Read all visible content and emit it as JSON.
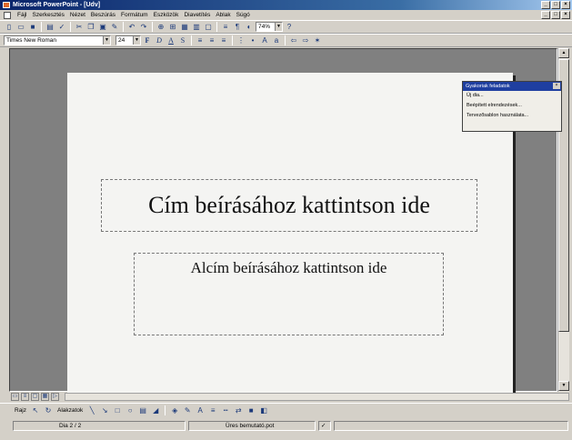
{
  "window": {
    "title": "Microsoft PowerPoint - [Udv]",
    "controls": [
      "_",
      "□",
      "×"
    ]
  },
  "menubar": {
    "items": [
      "Fájl",
      "Szerkesztés",
      "Nézet",
      "Beszúrás",
      "Formátum",
      "Eszközök",
      "Diavetítés",
      "Ablak",
      "Súgó"
    ]
  },
  "toolbar": {
    "zoom": "74%",
    "font_name": "Times New Roman",
    "font_size": "24",
    "format_labels": {
      "bold": "F",
      "italic": "D",
      "underline": "A",
      "shadow": "S"
    }
  },
  "slide": {
    "title_placeholder": "Cím beírásához kattintson ide",
    "subtitle_placeholder": "Alcím beírásához kattintson ide"
  },
  "task_pane": {
    "header": "Gyakoriak feladatok",
    "items": [
      "Új dia...",
      "Beépített elrendezések...",
      "Tervezősablon használata..."
    ]
  },
  "drawing_toolbar": {
    "draw_label": "Rajz",
    "autoshapes_label": "Alakzatok"
  },
  "status": {
    "slide_position": "Dia 2 / 2",
    "template": "Üres bemutató.pot"
  },
  "colors": {
    "titlebar": "#0a246a",
    "face": "#d4d0c8",
    "workspace": "#808080",
    "taskpane_header": "#1f3fa0"
  }
}
